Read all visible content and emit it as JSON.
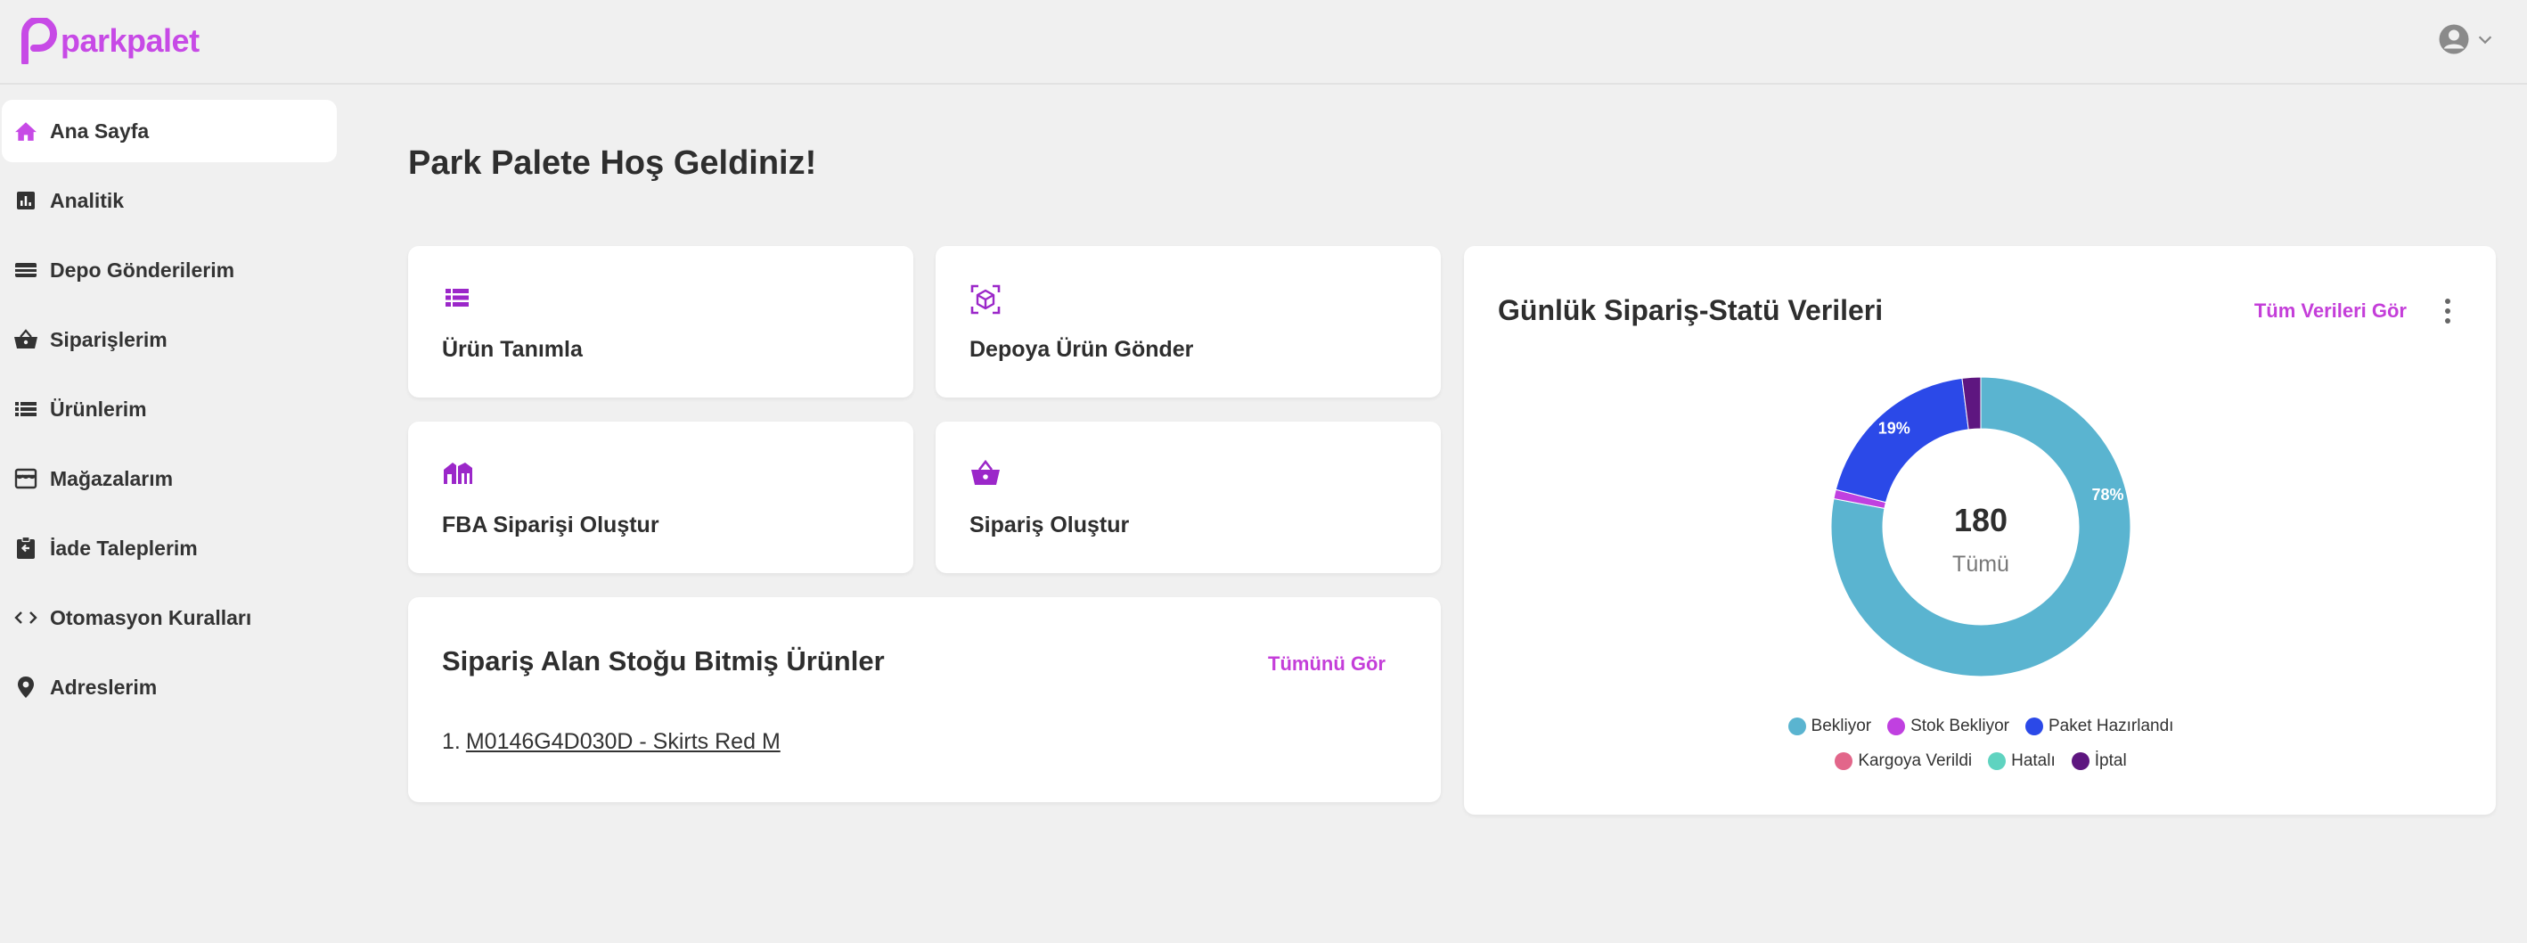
{
  "app": {
    "logo_text": "parkpalet",
    "brand_color": "#c74ae6"
  },
  "sidebar": {
    "items": [
      {
        "label": "Ana Sayfa",
        "icon": "home-icon",
        "active": true
      },
      {
        "label": "Analitik",
        "icon": "analytics-icon"
      },
      {
        "label": "Depo Gönderilerim",
        "icon": "shipments-icon"
      },
      {
        "label": "Siparişlerim",
        "icon": "basket-icon"
      },
      {
        "label": "Ürünlerim",
        "icon": "list-icon"
      },
      {
        "label": "Mağazalarım",
        "icon": "store-icon"
      },
      {
        "label": "İade Taleplerim",
        "icon": "return-icon"
      },
      {
        "label": "Otomasyon Kuralları",
        "icon": "code-icon"
      },
      {
        "label": "Adreslerim",
        "icon": "location-pin-icon"
      }
    ]
  },
  "main": {
    "title": "Park Palete Hoş Geldiniz!",
    "actions": [
      {
        "label": "Ürün Tanımla",
        "icon": "list-icon"
      },
      {
        "label": "Depoya Ürün Gönder",
        "icon": "box-scan-icon"
      },
      {
        "label": "FBA Siparişi Oluştur",
        "icon": "warehouse-icon"
      },
      {
        "label": "Sipariş Oluştur",
        "icon": "basket-icon"
      }
    ],
    "out_of_stock": {
      "title": "Sipariş Alan Stoğu Bitmiş Ürünler",
      "link": "Tümünü Gör",
      "items": [
        {
          "number": "1.",
          "label": "M0146G4D030D - Skirts Red M"
        }
      ]
    }
  },
  "chart_card": {
    "title": "Günlük Sipariş-Statü Verileri",
    "link": "Tüm Verileri Gör",
    "center_value": "180",
    "center_label": "Tümü"
  },
  "chart_data": {
    "type": "pie",
    "donut": true,
    "total": 180,
    "series": [
      {
        "name": "Bekliyor",
        "value": 78,
        "color": "#5ab4d0",
        "label": "78%"
      },
      {
        "name": "Stok Bekliyor",
        "value": 1,
        "color": "#c040e0",
        "label": ""
      },
      {
        "name": "Paket Hazırlandı",
        "value": 19,
        "color": "#2b49e8",
        "label": "19%"
      },
      {
        "name": "Kargoya Verildi",
        "value": 0,
        "color": "#e2668a",
        "label": ""
      },
      {
        "name": "Hatalı",
        "value": 0,
        "color": "#5fd3c0",
        "label": ""
      },
      {
        "name": "İptal",
        "value": 2,
        "color": "#5e1680",
        "label": ""
      }
    ],
    "legend_position": "bottom"
  }
}
